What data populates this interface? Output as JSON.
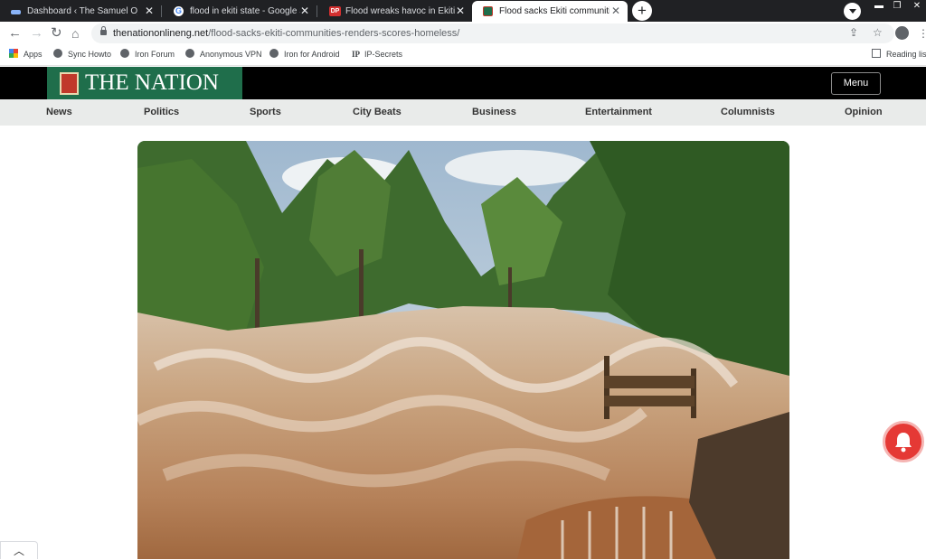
{
  "browser": {
    "tabs": [
      {
        "title": "Dashboard ‹ The Samuel Ojekwe",
        "icon": "wordpress-dashboard-icon",
        "active": false
      },
      {
        "title": "flood in ekiti state - Google Sear",
        "icon": "google-icon",
        "active": false
      },
      {
        "title": "Flood wreaks havoc in Ekiti comm",
        "icon": "dp-news-icon",
        "active": false
      },
      {
        "title": "Flood sacks Ekiti communities, re",
        "icon": "the-nation-icon",
        "active": true
      }
    ],
    "new_tab_label": "+",
    "url_host": "thenationonlineng.net",
    "url_path": "/flood-sacks-ekiti-communities-renders-scores-homeless/",
    "bookmarks": [
      {
        "label": "Apps",
        "icon": "apps-grid-icon"
      },
      {
        "label": "Sync Howto",
        "icon": "globe-icon"
      },
      {
        "label": "Iron Forum",
        "icon": "globe-icon"
      },
      {
        "label": "Anonymous VPN",
        "icon": "globe-icon"
      },
      {
        "label": "Iron for Android",
        "icon": "globe-icon"
      },
      {
        "label": "IP-Secrets",
        "icon": "ip-icon"
      }
    ],
    "reading_list": "Reading lis"
  },
  "site": {
    "logo_text": "THE NATION",
    "menu_label": "Menu",
    "nav": [
      "News",
      "Politics",
      "Sports",
      "City Beats",
      "Business",
      "Entertainment",
      "Columnists",
      "Opinion"
    ]
  },
  "colors": {
    "brand_green": "#1f6e4b",
    "header_black": "#000000",
    "nav_bg": "#e9ebea",
    "bell_red": "#e53935"
  }
}
